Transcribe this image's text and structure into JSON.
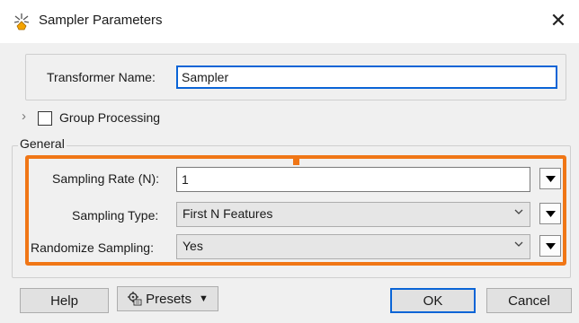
{
  "window": {
    "title": "Sampler Parameters",
    "close_glyph": "✕"
  },
  "transformer_name": {
    "label": "Transformer Name:",
    "value": "Sampler"
  },
  "group_processing": {
    "label": "Group Processing",
    "checked": false,
    "expander_glyph": "›"
  },
  "general": {
    "title": "General",
    "sampling_rate": {
      "label": "Sampling Rate (N):",
      "value": "1"
    },
    "sampling_type": {
      "label": "Sampling Type:",
      "value": "First N Features"
    },
    "randomize_sampling": {
      "label": "Randomize Sampling:",
      "value": "Yes"
    }
  },
  "footer": {
    "help_label": "Help",
    "presets_label": "Presets",
    "presets_arrow": "▼",
    "ok_label": "OK",
    "cancel_label": "Cancel"
  },
  "colors": {
    "highlight_border": "#f07616",
    "focus_border": "#0a64d6",
    "dialog_background": "#f0f0f0"
  },
  "icons": {
    "title_icon": "sampler-transformer-icon",
    "presets_icon": "presets-gear-icon"
  }
}
